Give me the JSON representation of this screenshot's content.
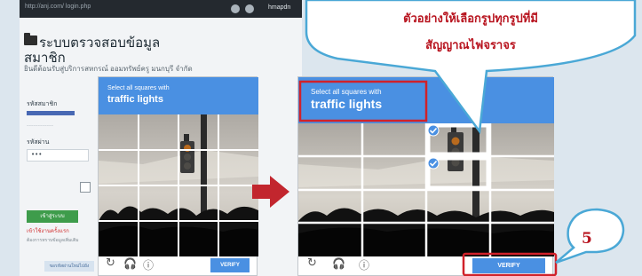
{
  "page": {
    "url": "http://anj.com/ login.php",
    "user": "hmapdn",
    "title_line1": "ระบบตรวจสอบข้อมูล",
    "title_line2": "สมาชิก",
    "welcome": "ยินดีต้อนรับสู่บริการสหกรณ์ ออมทรัพย์ครู มนกบุรี จำกัด",
    "member_label": "รหัสสมาชิก",
    "password_label": "รหัสผ่าน",
    "password_value": "•••",
    "login_button": "เข้าสู่ระบบ",
    "warning_text": "เข้าใช้งานครั้งแรก",
    "info_text": "ต้องการทราบข้อมูลเพิ่มเติม",
    "bottom_button": "ขอรหัสผ่านใหม่ไปยัง"
  },
  "captcha_left": {
    "instruction": "Select all squares with",
    "target": "traffic lights",
    "verify_label": "VERIFY"
  },
  "captcha_right": {
    "instruction": "Select all squares with",
    "target": "traffic lights",
    "verify_label": "VERIFY"
  },
  "icons": {
    "reload": "↻",
    "audio": "🎧",
    "info": "ⓘ"
  },
  "callout": {
    "line1": "ตัวอย่างให้เลือกรูปทุกรูปที่มี",
    "line2": "สัญญาณไฟจราจร",
    "step_number": "5"
  },
  "colors": {
    "captcha_blue": "#4a90e2",
    "highlight_red": "#d0212a",
    "callout_text": "#b8141f"
  }
}
